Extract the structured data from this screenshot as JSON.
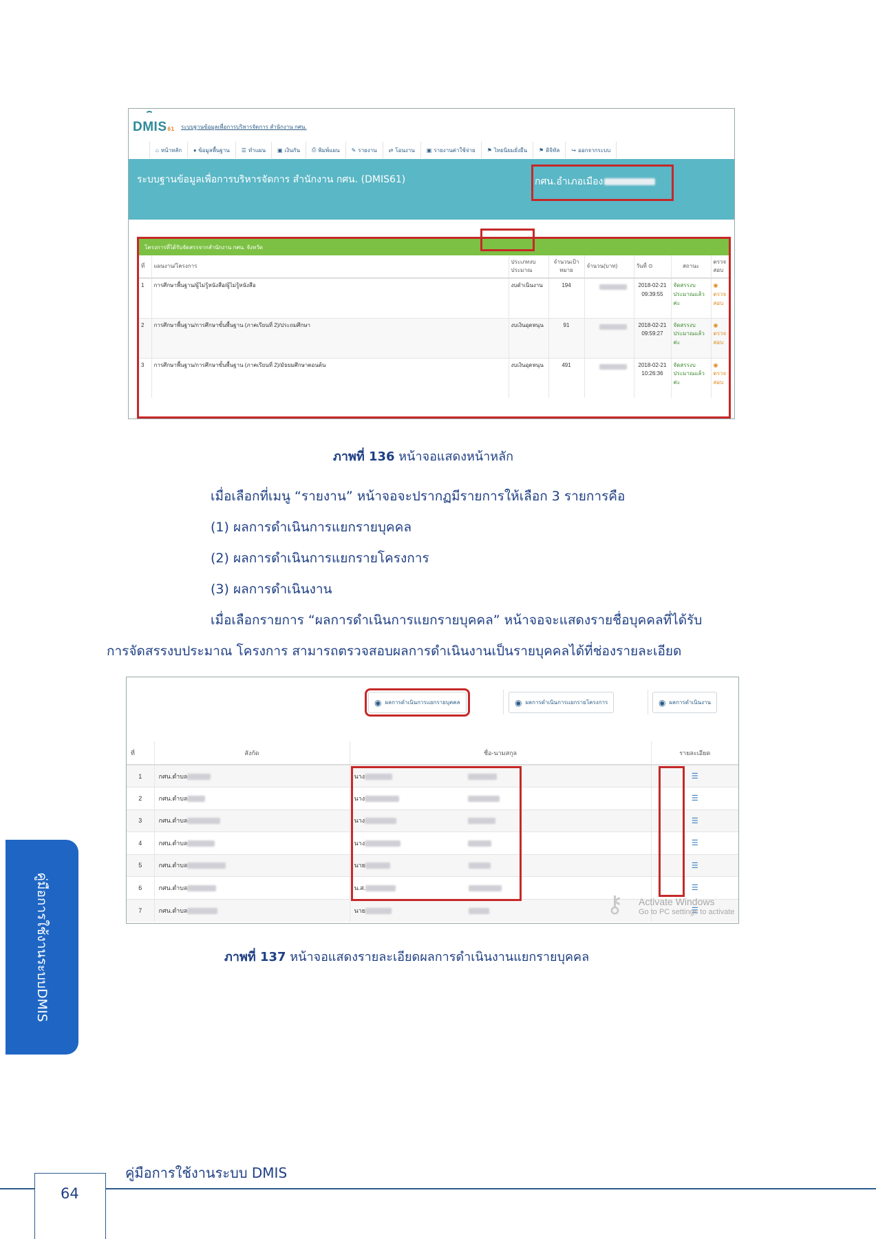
{
  "shot1": {
    "logo_main": "DMIS",
    "logo_sub": "61",
    "system_small": "ระบบฐานข้อมูลเพื่อการบริหารจัดการ สำนักงาน กศน.",
    "menu": [
      {
        "icon": "home-icon",
        "glyph": "⌂",
        "label": "หน้าหลัก"
      },
      {
        "icon": "map-pin-icon",
        "glyph": "♦",
        "label": "ข้อมูลพื้นฐาน"
      },
      {
        "icon": "list-icon",
        "glyph": "☰",
        "label": "ทำแผน"
      },
      {
        "icon": "money-icon",
        "glyph": "▣",
        "label": "เงินกัน"
      },
      {
        "icon": "print-icon",
        "glyph": "⎙",
        "label": "พิมพ์แผน"
      },
      {
        "icon": "pencil-icon",
        "glyph": "✎",
        "label": "รายงาน"
      },
      {
        "icon": "transfer-icon",
        "glyph": "⇄",
        "label": "โอนงาน"
      },
      {
        "icon": "money-icon",
        "glyph": "▣",
        "label": "รายงานค่าใช้จ่าย"
      },
      {
        "icon": "flag-icon",
        "glyph": "⚑",
        "label": "ไทยนิยมยั่งยืน"
      },
      {
        "icon": "flag-icon",
        "glyph": "⚑",
        "label": "ดิจิทัล"
      },
      {
        "icon": "logout-icon",
        "glyph": "↪",
        "label": "ออกจากระบบ"
      }
    ],
    "banner_title": "ระบบฐานข้อมูลเพื่อการบริหารจัดการ สำนักงาน กศน. (DMIS61)",
    "banner_unit": "กศน.อำเภอเมือง",
    "table_title": "โครงการที่ได้รับจัดสรรจากสำนักงาน กศน. จังหวัด",
    "headers": {
      "no": "ที่",
      "project": "แผนงาน/โครงการ",
      "budget_type": "ประเภทงบประมาณ",
      "target": "จำนวนเป้าหมาย",
      "amount": "จำนวน(บาท)",
      "date": "วันที่",
      "status": "สถานะ",
      "check": "ตรวจสอบ"
    },
    "rows": [
      {
        "no": "1",
        "project": "การศึกษาพื้นฐาน/ผู้ไม่รู้หนังสือ/ผู้ไม่รู้หนังสือ",
        "budget_type": "งบดำเนินงาน",
        "target": "194",
        "date": "2018-02-21",
        "time": "09:39:55",
        "status": "จัดสรรงบประมาณแล้วค่ะ",
        "check": "ตรวจสอบ"
      },
      {
        "no": "2",
        "project": "การศึกษาพื้นฐาน/การศึกษาขั้นพื้นฐาน (ภาคเรียนที่ 2)/ประถมศึกษา",
        "budget_type": "งบเงินอุดหนุน",
        "target": "91",
        "date": "2018-02-21",
        "time": "09:59:27",
        "status": "จัดสรรงบประมาณแล้วค่ะ",
        "check": "ตรวจสอบ"
      },
      {
        "no": "3",
        "project": "การศึกษาพื้นฐาน/การศึกษาขั้นพื้นฐาน (ภาคเรียนที่ 2)/มัธยมศึกษาตอนต้น",
        "budget_type": "งบเงินอุดหนุน",
        "target": "491",
        "date": "2018-02-21",
        "time": "10:26:36",
        "status": "จัดสรรงบประมาณแล้วค่ะ",
        "check": "ตรวจสอบ"
      }
    ]
  },
  "caption1": {
    "label": "ภาพที่ 136",
    "text": "หน้าจอแสดงหน้าหลัก"
  },
  "paragraphs": {
    "p1": "เมื่อเลือกที่เมนู “รายงาน” หน้าจอจะปรากฏมีรายการให้เลือก 3 รายการคือ",
    "p2": "(1) ผลการดำเนินการแยกรายบุคคล",
    "p3": "(2) ผลการดำเนินการแยกรายโครงการ",
    "p4": "(3) ผลการดำเนินงาน",
    "p5a": "เมื่อเลือกรายการ “ผลการดำเนินการแยกรายบุคคล” หน้าจอจะแสดงรายชื่อบุคคลที่ได้รับ",
    "p5b": "การจัดสรรงบประมาณ โครงการ สามารถตรวจสอบผลการดำเนินงานเป็นรายบุคคลได้ที่ช่องรายละเอียด"
  },
  "shot2": {
    "tabs": [
      "ผลการดำเนินการแยกรายบุคคล",
      "ผลการดำเนินการแยกรายโครงการ",
      "ผลการดำเนินงาน"
    ],
    "headers": {
      "no": "ที่",
      "affiliation": "สังกัด",
      "name": "ชื่อ-นามสกุล",
      "detail": "รายละเอียด"
    },
    "rows": [
      {
        "no": "1",
        "affiliation": "กศน.ตำบล",
        "prefix": "นาง"
      },
      {
        "no": "2",
        "affiliation": "กศน.ตำบล",
        "prefix": "นาง"
      },
      {
        "no": "3",
        "affiliation": "กศน.ตำบล",
        "prefix": "นาง"
      },
      {
        "no": "4",
        "affiliation": "กศน.ตำบล",
        "prefix": "นาง"
      },
      {
        "no": "5",
        "affiliation": "กศน.ตำบล",
        "prefix": "นาย"
      },
      {
        "no": "6",
        "affiliation": "กศน.ตำบล",
        "prefix": "น.ส."
      },
      {
        "no": "7",
        "affiliation": "กศน.ตำบล",
        "prefix": "นาย"
      }
    ],
    "watermark_line1": "Activate Windows",
    "watermark_line2": "Go to PC settings to activate"
  },
  "caption2": {
    "label": "ภาพที่ 137",
    "text": "หน้าจอแสดงรายละเอียดผลการดำเนินงานแยกรายบุคคล"
  },
  "side_tab": "คู่มือการใช้งานระบบDMIS",
  "footer": {
    "title": "คู่มือการใช้งานระบบ DMIS",
    "page": "64"
  }
}
